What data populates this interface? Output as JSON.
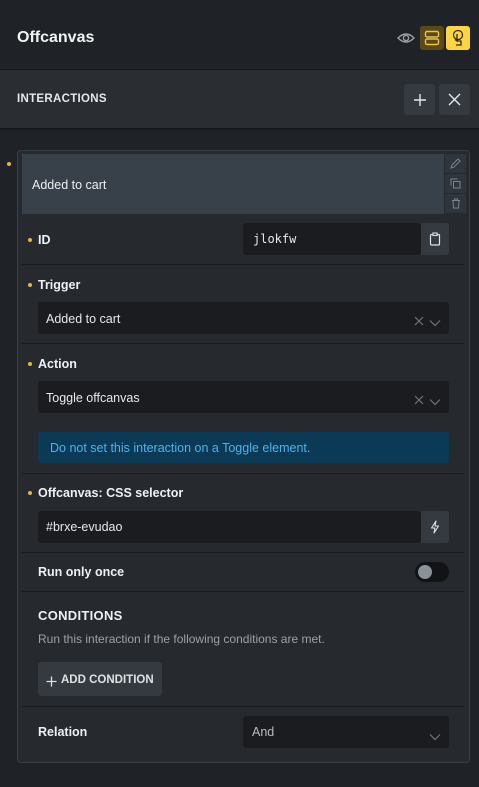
{
  "header": {
    "title": "Offcanvas",
    "icons": [
      "eye-icon",
      "layout-toggle-icon",
      "interaction-icon"
    ],
    "accent": "#ffd53e"
  },
  "interactions": {
    "label": "INTERACTIONS",
    "add_icon": "plus-icon",
    "close_icon": "close-icon"
  },
  "item": {
    "title": "Added to cart",
    "action_icons": [
      "edit-icon",
      "duplicate-icon",
      "delete-icon"
    ]
  },
  "fields": {
    "id_label": "ID",
    "id_value": "jlokfw",
    "trigger_label": "Trigger",
    "trigger_value": "Added to cart",
    "action_label": "Action",
    "action_value": "Toggle offcanvas",
    "notice": "Do not set this interaction on a Toggle element.",
    "selector_label": "Offcanvas: CSS selector",
    "selector_value": "#brxe-evudao",
    "run_once_label": "Run only once",
    "run_once_enabled": false
  },
  "conditions": {
    "title": "CONDITIONS",
    "description": "Run this interaction if the following conditions are met.",
    "add_label": "ADD CONDITION"
  },
  "relation": {
    "label": "Relation",
    "value": "And"
  }
}
